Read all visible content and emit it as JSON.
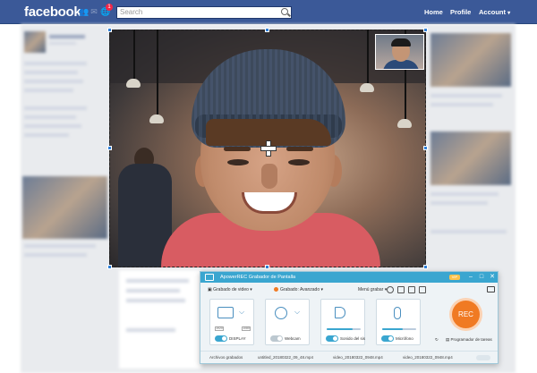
{
  "facebook": {
    "logo": "facebook",
    "notification_count": "1",
    "search_placeholder": "Search",
    "nav": [
      "Home",
      "Profile",
      "Account"
    ],
    "account_caret": "▾"
  },
  "recorder": {
    "title": "ApowerREC Grabador de Pantalla",
    "badge": "VIP",
    "window_controls": [
      "–",
      "□",
      "✕"
    ],
    "toolbar": {
      "mode": "Grabado de video",
      "state": "Grabado: Avanzado",
      "options": "Menú grabar"
    },
    "cards": [
      {
        "label": "DISPLAY",
        "icon": "monitor-icon",
        "enabled": true
      },
      {
        "label": "Webcam",
        "icon": "webcam-icon",
        "enabled": false
      },
      {
        "label": "Sonido del sis",
        "icon": "speaker-icon",
        "enabled": true,
        "level": 0.75
      },
      {
        "label": "Micrófono",
        "icon": "microphone-icon",
        "enabled": true,
        "level": 0.6
      }
    ],
    "res_boxes": [
      "1920",
      "1080"
    ],
    "rec_label": "REC",
    "rec_extras": [
      "Programador de tareas"
    ],
    "files_label": "Archivos grabados",
    "files": [
      "untitled_20180322_09_48.mp4",
      "video_20180322_0948.mp4",
      "video_20180322_0948.mp4"
    ],
    "accent": "#3aa6d0",
    "rec_color": "#f07a23"
  }
}
